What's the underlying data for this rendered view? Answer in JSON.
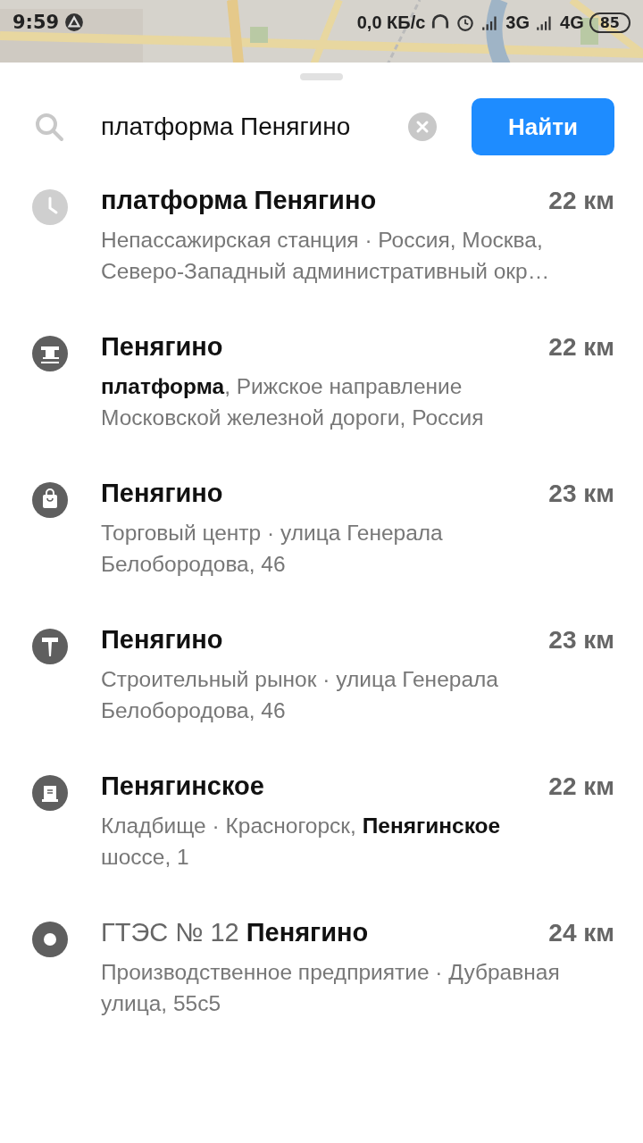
{
  "status_bar": {
    "time": "9:59",
    "speed": "0,0 КБ/с",
    "network_1": "3G",
    "network_2": "4G",
    "battery": "85"
  },
  "search": {
    "value": "платформа Пенягино",
    "button": "Найти"
  },
  "results": [
    {
      "kind": "history",
      "title": "платформа Пенягино",
      "distance": "22 км",
      "description": "Непассажирская станция · Россия, Москва, Северо-Западный административный окр…"
    },
    {
      "kind": "train",
      "title": "Пенягино",
      "distance": "22 км",
      "description": "**платформа**, Рижское направление Московской железной дороги, Россия"
    },
    {
      "kind": "shop",
      "title": "Пенягино",
      "distance": "23 км",
      "description": "Торговый центр · улица Генерала Белобородова, 46"
    },
    {
      "kind": "hammer",
      "title": "Пенягино",
      "distance": "23 км",
      "description": "Строительный рынок · улица Генерала Белобородова, 46"
    },
    {
      "kind": "grave",
      "title": "Пенягинское",
      "distance": "22 км",
      "description": "Кладбище · Красногорск, **Пенягинское** шоссе, 1"
    },
    {
      "kind": "place",
      "title_prefix": "ГТЭС № 12",
      "title": "Пенягино",
      "distance": "24 км",
      "description": "Производственное предприятие · Дубравная улица, 55с5"
    }
  ]
}
